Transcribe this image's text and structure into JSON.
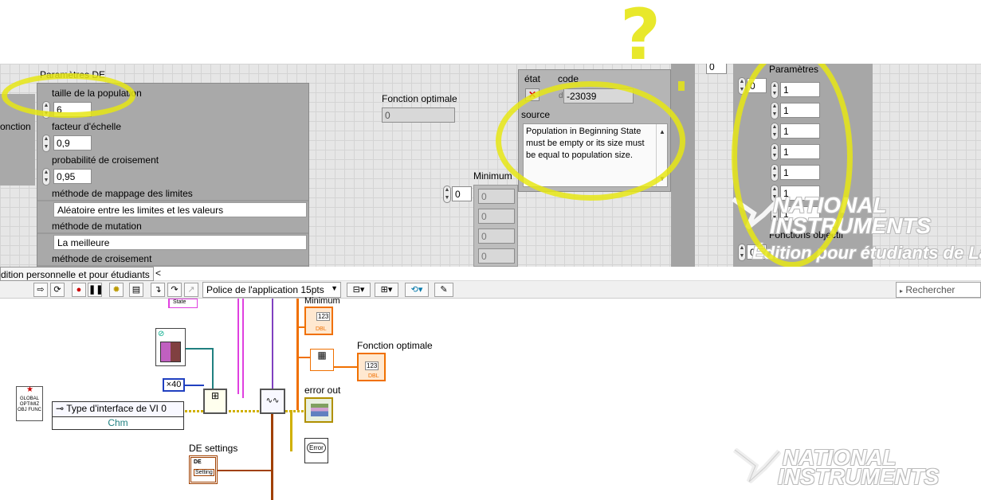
{
  "annotation": {
    "question_mark": "?"
  },
  "front_panel": {
    "de_params": {
      "title": "Paramètres DE",
      "pop_size_label": "taille de la population",
      "pop_size_value": "6",
      "scale_label": "facteur d'échelle",
      "scale_value": "0,9",
      "crossover_prob_label": "probabilité de croisement",
      "crossover_prob_value": "0,95",
      "bounds_label": "méthode de mappage des limites",
      "bounds_value": "Aléatoire entre les limites et les valeurs",
      "mutation_label": "méthode de mutation",
      "mutation_value": "La meilleure",
      "crossover_label": "méthode de croisement"
    },
    "left_partial_label": "onction",
    "optimal_function": {
      "label": "Fonction optimale",
      "value": "0"
    },
    "minimum": {
      "label": "Minimum",
      "index": "0",
      "values": [
        "0",
        "0",
        "0",
        "0"
      ]
    },
    "error_cluster": {
      "status_label": "état",
      "status_icon": "x-icon",
      "code_label": "code",
      "code_value": "-23039",
      "code_prefix": "d",
      "source_label": "source",
      "source_text": "Population in Beginning State must be empty or its size must be equal to population size."
    },
    "top_index": "0",
    "parametres": {
      "title": "Paramètres",
      "index": "0",
      "values": [
        "1",
        "1",
        "1",
        "1",
        "1",
        "1",
        "1"
      ],
      "objective_label": "Fonctions objectif",
      "objective_index": "0"
    },
    "watermark": {
      "line1": "NATIONAL",
      "line2": "INSTRUMENTS",
      "edition": "Édition pour étudiants de La"
    }
  },
  "status_strip": {
    "edition": "dition personnelle et pour étudiants",
    "arrow": "<"
  },
  "toolbar": {
    "font_select": "Police de l'application 15pts",
    "search_placeholder": "Rechercher"
  },
  "block_diagram": {
    "minimum_label": "Minimum",
    "minimum_term": "123",
    "optimal_label": "Fonction optimale",
    "optimal_term": "123",
    "dbl": "DBL",
    "error_out_label": "error out",
    "error_term": "Error",
    "de_settings_label": "DE settings",
    "de_settings_term": "DE",
    "de_settings_sub": "Setting",
    "constant_40": "×40",
    "vi_ref_label": "Type d'interface de VI 0",
    "vi_ref_sub": "Chm",
    "global_icon": "GLOBAL OPTIMIZ OBJ FUNC",
    "status_top": "State",
    "watermark": {
      "line1": "NATIONAL",
      "line2": "INSTRUMENTS"
    }
  }
}
